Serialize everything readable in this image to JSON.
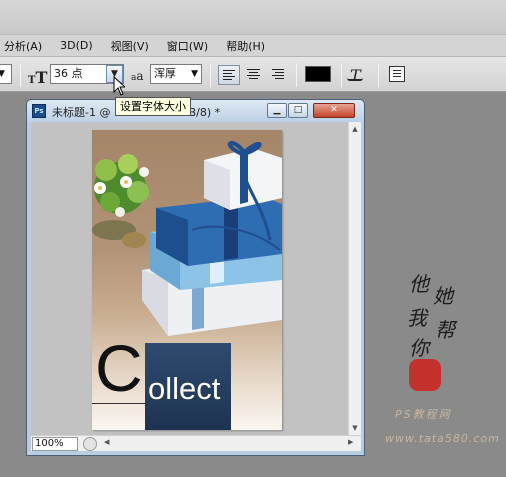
{
  "menu": {
    "items": [
      "分析(A)",
      "3D(D)",
      "视图(V)",
      "窗口(W)",
      "帮助(H)"
    ]
  },
  "options_bar": {
    "font_size_value": "36 点",
    "antialias_value": "浑厚",
    "aa_glyph": "a a",
    "text_color": "#000000"
  },
  "tooltip": {
    "text": "设置字体大小"
  },
  "document": {
    "title": "未标题-1 @ 100% (RGB/8) *",
    "title_left": "未标题-1 @",
    "title_right": "RGB/8) *",
    "zoom": "100%",
    "ps_icon_label": "Ps"
  },
  "artwork": {
    "big_letter": "C",
    "rest_text": "ollect",
    "box_color": "#2e4b70"
  },
  "watermark": {
    "chars": [
      "他",
      "她",
      "我",
      "帮",
      "你"
    ],
    "line1": "PS教程网",
    "line2": "www.tata580.com",
    "seal_color": "#c4312c"
  },
  "icons": {
    "type_tool": "type-orientation-icon",
    "dropdown": "chevron-down-icon",
    "align_left": "align-left-icon",
    "align_center": "align-center-icon",
    "align_right": "align-right-icon",
    "warp_text": "warp-text-icon",
    "panels": "character-panel-icon"
  }
}
